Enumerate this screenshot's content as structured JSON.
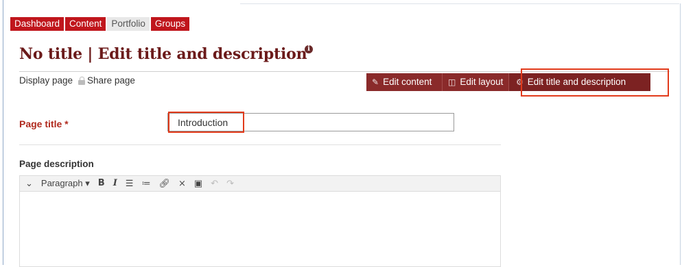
{
  "nav": {
    "items": [
      {
        "label": "Dashboard",
        "active": false
      },
      {
        "label": "Content",
        "active": false
      },
      {
        "label": "Portfolio",
        "active": true
      },
      {
        "label": "Groups",
        "active": false
      }
    ]
  },
  "page": {
    "title": "No title | Edit title and description",
    "info_icon": "i"
  },
  "sublinks": {
    "display_page": "Display page",
    "share_page": "Share page"
  },
  "toolbar": {
    "edit_content": "Edit content",
    "edit_layout": "Edit layout",
    "edit_title_description": "Edit title and description"
  },
  "form": {
    "page_title_label": "Page title *",
    "page_title_value": "Introduction",
    "page_description_label": "Page description"
  },
  "editor": {
    "paragraph_label": "Paragraph",
    "icons": [
      "chevron-down-icon",
      "bold-icon",
      "italic-icon",
      "bullet-list-icon",
      "numbered-list-icon",
      "link-icon",
      "unlink-icon",
      "image-icon",
      "undo-icon",
      "redo-icon"
    ]
  },
  "colors": {
    "nav_red": "#c0161c",
    "title_brown": "#6b1a1a",
    "button_maroon": "#8a2a2a",
    "highlight_red": "#e23a1a"
  }
}
